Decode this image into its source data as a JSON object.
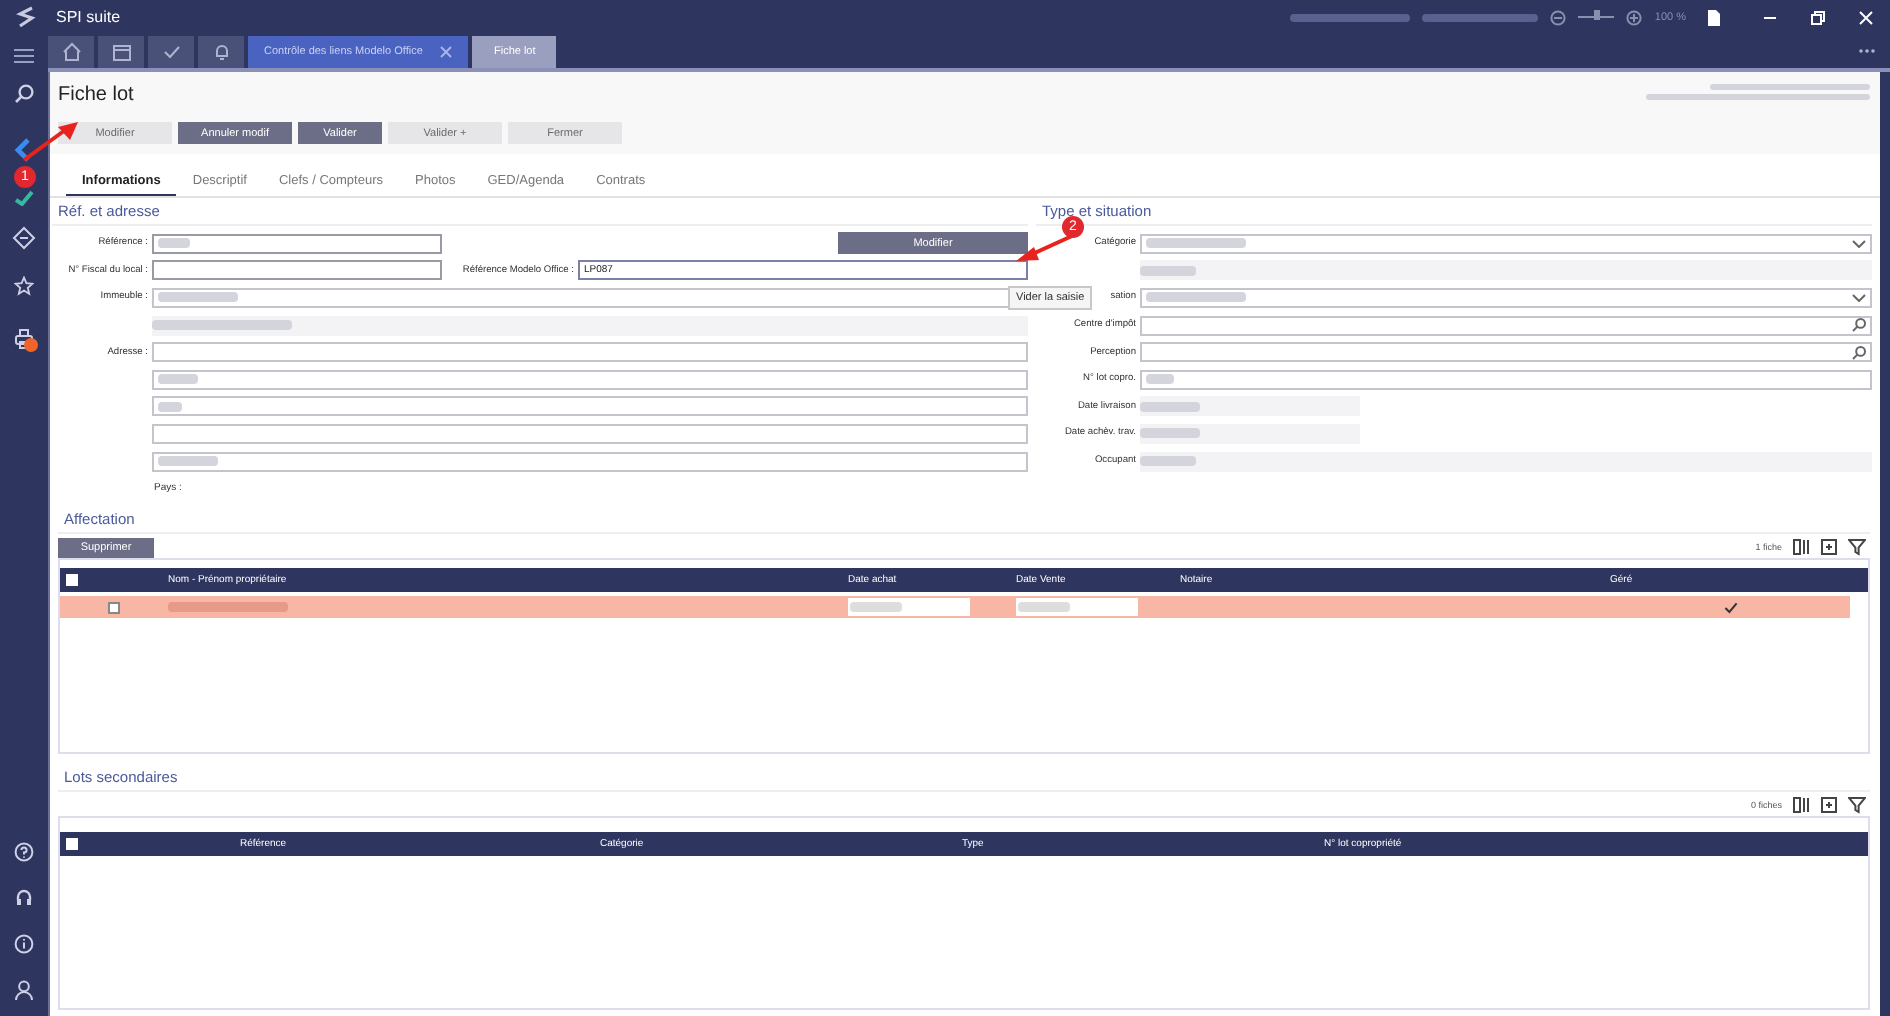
{
  "window": {
    "title": "SPI suite",
    "zoom": {
      "label": "100 %",
      "level": 0.5
    }
  },
  "doc_tabs": [
    {
      "label": "Contrôle des liens Modelo Office",
      "selected": false
    },
    {
      "label": "Fiche lot",
      "selected": true
    }
  ],
  "page": {
    "title": "Fiche lot"
  },
  "toolbar": [
    {
      "label": "Modifier",
      "disabled": true
    },
    {
      "label": "Annuler modif",
      "disabled": false
    },
    {
      "label": "Valider",
      "disabled": false
    },
    {
      "label": "Valider +",
      "disabled": true
    },
    {
      "label": "Fermer",
      "disabled": true
    }
  ],
  "tabs": [
    {
      "label": "Informations",
      "selected": true
    },
    {
      "label": "Descriptif",
      "selected": false
    },
    {
      "label": "Clefs / Compteurs",
      "selected": false
    },
    {
      "label": "Photos",
      "selected": false
    },
    {
      "label": "GED/Agenda",
      "selected": false
    },
    {
      "label": "Contrats",
      "selected": false
    }
  ],
  "ref_section": {
    "title": "Réf. et adresse",
    "reference_label": "Référence :",
    "fiscal_label": "N° Fiscal du local :",
    "modelo_label": "Référence Modelo Office :",
    "modelo_value": "LP087",
    "modify_button": "Modifier",
    "building_label": "Immeuble :",
    "address_label": "Adresse :",
    "country_label": "Pays :"
  },
  "tooltip": {
    "text": "Vider la saisie"
  },
  "type_section": {
    "title": "Type et situation",
    "rows": [
      {
        "label": "Catégorie",
        "kind": "select"
      },
      {
        "kind": "blurred"
      },
      {
        "label": "sation",
        "kind": "select"
      },
      {
        "label": "Centre d'impôt",
        "kind": "search"
      },
      {
        "label": "Perception",
        "kind": "search"
      },
      {
        "label": "N° lot copro.",
        "kind": "text"
      },
      {
        "label": "Date livraison",
        "kind": "date"
      },
      {
        "label": "Date achèv. trav.",
        "kind": "date"
      },
      {
        "label": "Occupant",
        "kind": "blurred"
      }
    ]
  },
  "affectation": {
    "title": "Affectation",
    "delete_button": "Supprimer",
    "count": "1 fiche",
    "all_checked": false,
    "columns": [
      "Nom - Prénom propriétaire",
      "Date achat",
      "Date Vente",
      "Notaire",
      "Géré"
    ],
    "rows": [
      {
        "checked": false,
        "managed": true,
        "highlighted": true
      }
    ]
  },
  "lots": {
    "title": "Lots secondaires",
    "count": "0 fiches",
    "all_checked": false,
    "columns": [
      "Référence",
      "Catégorie",
      "Type",
      "N° lot copropriété"
    ]
  },
  "annotations": [
    {
      "number": "1"
    },
    {
      "number": "2"
    }
  ]
}
